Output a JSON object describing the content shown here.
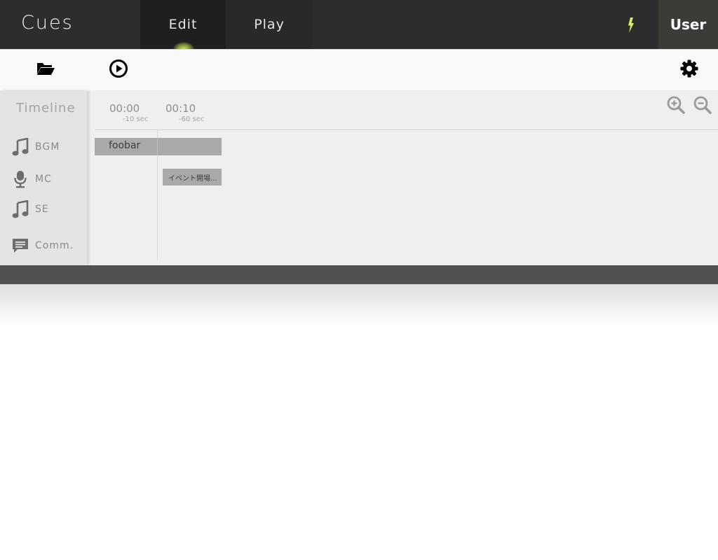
{
  "header": {
    "app_title": "Cues",
    "tabs": [
      {
        "label": "Edit",
        "active": true
      },
      {
        "label": "Play",
        "active": false
      }
    ],
    "status_icon": "flash-icon",
    "user_label": "User",
    "accent_color": "#d6f060"
  },
  "toolbar": {
    "icons": [
      "folder-open-icon",
      "play-circle-icon",
      "gear-icon"
    ]
  },
  "timeline": {
    "title": "Timeline",
    "tracks": [
      {
        "label": "BGM",
        "icon": "music-note-icon"
      },
      {
        "label": "MC",
        "icon": "microphone-icon"
      },
      {
        "label": "SE",
        "icon": "music-note-icon"
      },
      {
        "label": "Comm.",
        "icon": "comment-icon"
      }
    ],
    "markers": [
      {
        "time": "00:00",
        "sub": "-10 sec"
      },
      {
        "time": "00:10",
        "sub": "-60 sec"
      }
    ],
    "zoom_icons": [
      "zoom-in-icon",
      "zoom-out-icon"
    ],
    "cues": [
      {
        "label": "foobar",
        "track": "BGM"
      },
      {
        "label": "イベント開場...",
        "track": "MC"
      }
    ]
  }
}
